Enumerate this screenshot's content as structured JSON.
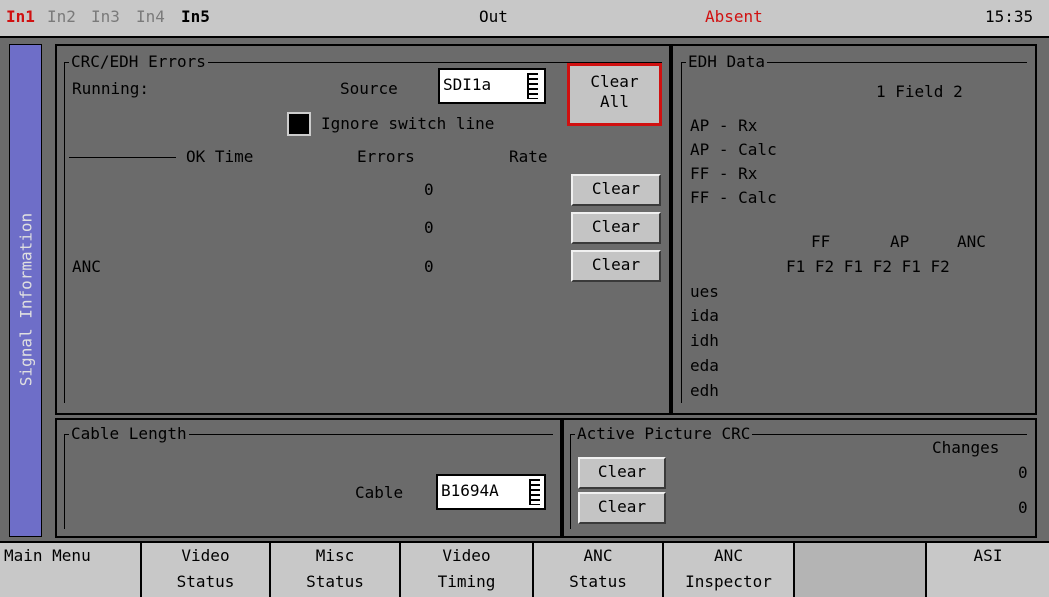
{
  "topbar": {
    "inputs": [
      "In1",
      "In2",
      "In3",
      "In4",
      "In5"
    ],
    "output_label": "Out",
    "status": "Absent",
    "time": "15:35"
  },
  "side_tab": "Signal Information",
  "crc": {
    "title": "CRC/EDH Errors",
    "running_label": "Running:",
    "source_label": "Source",
    "source_value": "SDI1a",
    "clear_all_line1": "Clear",
    "clear_all_line2": "All",
    "ignore_label": "Ignore switch line",
    "col_ok_time": "OK Time",
    "col_errors": "Errors",
    "col_rate": "Rate",
    "rows": [
      {
        "label": "",
        "errors": "0",
        "clear": "Clear"
      },
      {
        "label": "",
        "errors": "0",
        "clear": "Clear"
      },
      {
        "label": "ANC",
        "errors": "0",
        "clear": "Clear"
      }
    ]
  },
  "edh": {
    "title": "EDH Data",
    "field_header": "1 Field 2",
    "rows": [
      "AP - Rx",
      "AP - Calc",
      "FF - Rx",
      "FF - Calc"
    ],
    "grp_headers": [
      "FF",
      "AP",
      "ANC"
    ],
    "sub_headers": "F1 F2 F1 F2 F1 F2",
    "flags": [
      "ues",
      "ida",
      "idh",
      "eda",
      "edh"
    ]
  },
  "cable": {
    "title": "Cable Length",
    "cable_label": "Cable",
    "cable_value": "B1694A"
  },
  "apcrc": {
    "title": "Active Picture CRC",
    "changes_label": "Changes",
    "clear1": "Clear",
    "clear2": "Clear",
    "val1": "0",
    "val2": "0"
  },
  "menu": [
    {
      "line1": "Main Menu",
      "line2": ""
    },
    {
      "line1": "Video",
      "line2": "Status"
    },
    {
      "line1": "Misc",
      "line2": "Status"
    },
    {
      "line1": "Video",
      "line2": "Timing"
    },
    {
      "line1": "ANC",
      "line2": "Status"
    },
    {
      "line1": "ANC",
      "line2": "Inspector"
    },
    {
      "line1": "",
      "line2": ""
    },
    {
      "line1": "ASI",
      "line2": ""
    }
  ],
  "colors": {
    "active_red": "#d01010",
    "tab_blue": "#6e6ec8"
  }
}
